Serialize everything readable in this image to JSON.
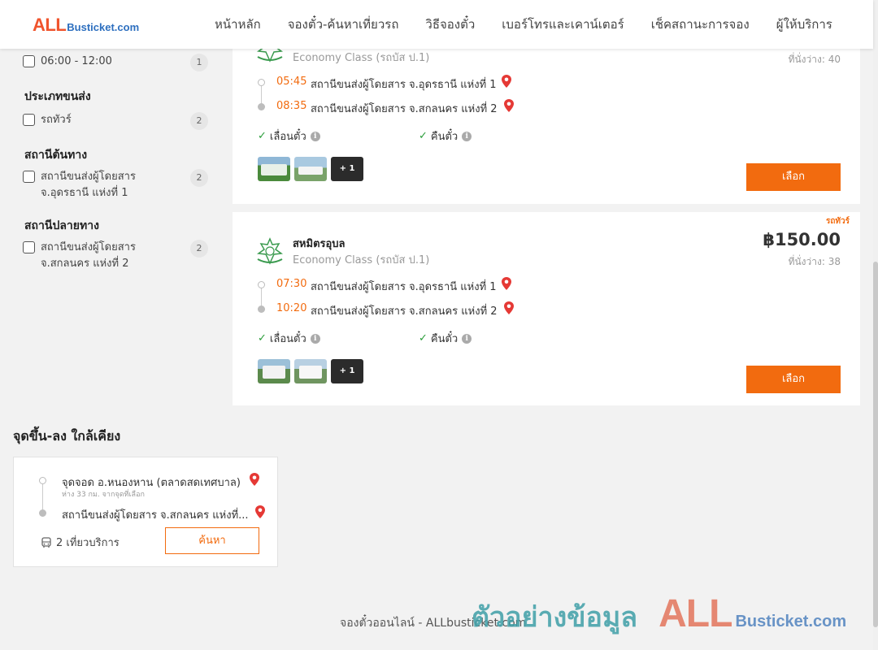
{
  "header": {
    "logo_all": "ALL",
    "logo_rest": "Busticket.com",
    "nav": [
      "หน้าหลัก",
      "จองตั๋ว-ค้นหาเที่ยวรถ",
      "วิธีจองตั๋ว",
      "เบอร์โทรและเคาน์เตอร์",
      "เช็คสถานะการจอง",
      "ผู้ให้บริการ"
    ]
  },
  "filters": {
    "time_option": {
      "label": "06:00 - 12:00",
      "count": "1"
    },
    "transport_type": {
      "heading": "ประเภทขนส่ง",
      "option": "รถทัวร์",
      "count": "2"
    },
    "origin": {
      "heading": "สถานีต้นทาง",
      "option": "สถานีขนส่งผู้โดยสาร จ.อุดรธานี แห่งที่ 1",
      "count": "2"
    },
    "destination": {
      "heading": "สถานีปลายทาง",
      "option": "สถานีขนส่งผู้โดยสาร จ.สกลนคร แห่งที่ 2",
      "count": "2"
    }
  },
  "trips": [
    {
      "operator": "",
      "bus_class": "Economy Class (รถบัส ป.1)",
      "seats": "ที่นั่งว่าง: 40",
      "depart_time": "05:45",
      "depart_stop": "สถานีขนส่งผู้โดยสาร จ.อุดรธานี แห่งที่ 1",
      "arrive_time": "08:35",
      "arrive_stop": "สถานีขนส่งผู้โดยสาร จ.สกลนคร แห่งที่ 2",
      "feature_1": "เลื่อนตั๋ว",
      "feature_2": "คืนตั๋ว",
      "more_photos": "+ 1",
      "select_label": "เลือก"
    },
    {
      "operator": "สหมิตรอุบล",
      "bus_class": "Economy Class (รถบัส ป.1)",
      "bus_type": "รถทัวร์",
      "price": "฿150.00",
      "seats": "ที่นั่งว่าง: 38",
      "depart_time": "07:30",
      "depart_stop": "สถานีขนส่งผู้โดยสาร จ.อุดรธานี แห่งที่ 1",
      "arrive_time": "10:20",
      "arrive_stop": "สถานีขนส่งผู้โดยสาร จ.สกลนคร แห่งที่ 2",
      "feature_1": "เลื่อนตั๋ว",
      "feature_2": "คืนตั๋ว",
      "more_photos": "+ 1",
      "select_label": "เลือก"
    }
  ],
  "nearby": {
    "title": "จุดขึ้น-ลง ใกล้เคียง",
    "from_stop": "จุดจอด อ.หนองหาน (ตลาดสดเทศบาล)",
    "distance": "ห่าง 33 กม. จากจุดที่เลือก",
    "to_stop": "สถานีขนส่งผู้โดยสาร จ.สกลนคร แห่งที่...",
    "trips": "2 เที่ยวบริการ",
    "search_label": "ค้นหา"
  },
  "footer": {
    "text": "จองตั๋วออนไลน์ - ALLbusticket.com",
    "watermark_thai": "ตัวอย่างข้อมูล",
    "watermark_all": "ALL",
    "watermark_rest": "Busticket.com"
  },
  "colors": {
    "accent": "#f26b0f",
    "brand_red": "#f0542d",
    "brand_blue": "#2d6fbf"
  }
}
